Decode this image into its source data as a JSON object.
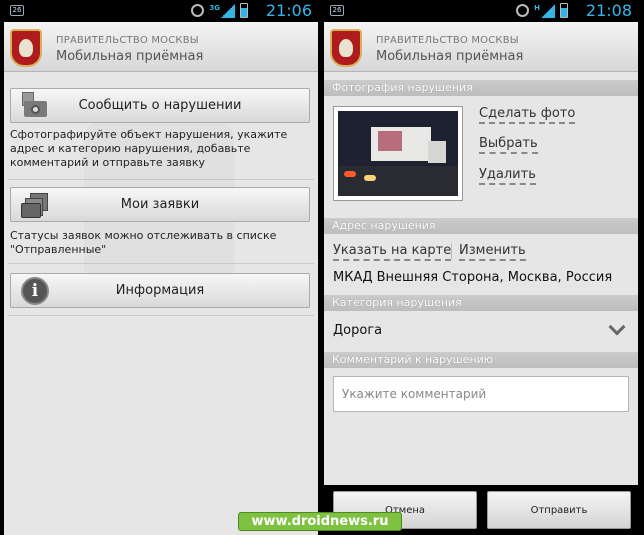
{
  "statusbar": {
    "notify_label": "26",
    "left_network": "3G",
    "right_network": "H",
    "left_time": "21:06",
    "right_time": "21:08"
  },
  "app": {
    "org": "ПРАВИТЕЛЬСТВО МОСКВЫ",
    "name": "Мобильная приёмная"
  },
  "home": {
    "report_button": "Сообщить о нарушении",
    "report_desc": "Сфотографируйте объект нарушения, укажите адрес и категорию нарушения, добавьте комментарий и отправьте заявку",
    "my_requests_button": "Мои заявки",
    "my_requests_desc": "Статусы заявок можно отслеживать в списке \"Отправленные\"",
    "info_button": "Информация"
  },
  "report": {
    "photo_header": "Фотография нарушения",
    "take_photo": "Сделать фото",
    "choose": "Выбрать",
    "delete": "Удалить",
    "address_header": "Адрес нарушения",
    "show_on_map": "Указать на карте",
    "change": "Изменить",
    "address_value": "МКАД Внешняя Сторона, Москва, Россия",
    "category_header": "Категория нарушения",
    "category_value": "Дорога",
    "comment_header": "Комментарий к нарушению",
    "comment_placeholder": "Укажите комментарий",
    "cancel": "Отмена",
    "send": "Отправить"
  },
  "watermark": "www.droidnews.ru",
  "colors": {
    "accent_blue": "#33b5e5",
    "section_gray": "#c4c4c4",
    "crest_red": "#b01c1c",
    "watermark_green": "#7fc241"
  }
}
